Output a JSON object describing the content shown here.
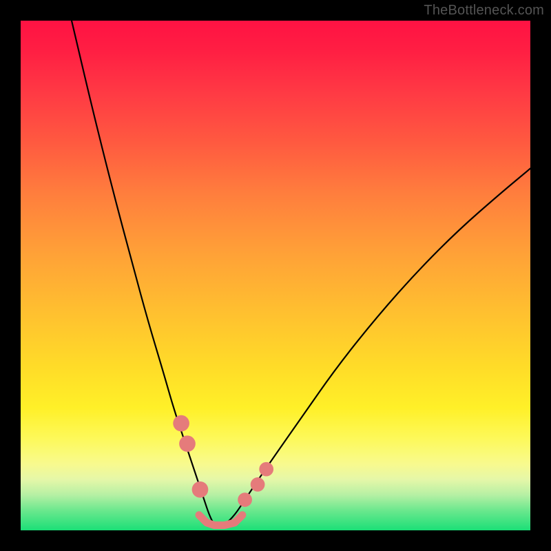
{
  "watermark": "TheBottleneck.com",
  "chart_data": {
    "type": "line",
    "title": "",
    "xlabel": "",
    "ylabel": "",
    "xlim": [
      0,
      100
    ],
    "ylim": [
      0,
      100
    ],
    "grid": false,
    "legend": false,
    "series": [
      {
        "name": "bottleneck-curve",
        "color": "#000000",
        "x": [
          10,
          14,
          18,
          22,
          25,
          28,
          30,
          32,
          34,
          36,
          37,
          38,
          40,
          42,
          44,
          48,
          55,
          62,
          70,
          78,
          86,
          94,
          100
        ],
        "y": [
          100,
          83,
          67,
          52,
          41,
          31,
          24,
          18,
          12,
          6,
          3,
          1,
          1,
          3,
          6,
          12,
          22,
          32,
          42,
          51,
          59,
          66,
          71
        ]
      }
    ],
    "markers": [
      {
        "name": "left-dot-1",
        "x": 31.5,
        "y": 21,
        "r": 1.6,
        "color": "#e57b7b"
      },
      {
        "name": "left-dot-2",
        "x": 32.7,
        "y": 17,
        "r": 1.6,
        "color": "#e57b7b"
      },
      {
        "name": "left-dot-3",
        "x": 35.2,
        "y": 8,
        "r": 1.6,
        "color": "#e57b7b"
      },
      {
        "name": "right-dot-1",
        "x": 44.0,
        "y": 6,
        "r": 1.4,
        "color": "#e57b7b"
      },
      {
        "name": "right-dot-2",
        "x": 46.5,
        "y": 9,
        "r": 1.4,
        "color": "#e57b7b"
      },
      {
        "name": "right-dot-3",
        "x": 48.2,
        "y": 12,
        "r": 1.4,
        "color": "#e57b7b"
      }
    ],
    "bottom_band": {
      "name": "bottom-marker-band",
      "color": "#e57b7b",
      "x": [
        35,
        36.5,
        38,
        40,
        42,
        43.5
      ],
      "y": [
        3,
        1.5,
        1,
        1,
        1.5,
        3
      ]
    }
  }
}
